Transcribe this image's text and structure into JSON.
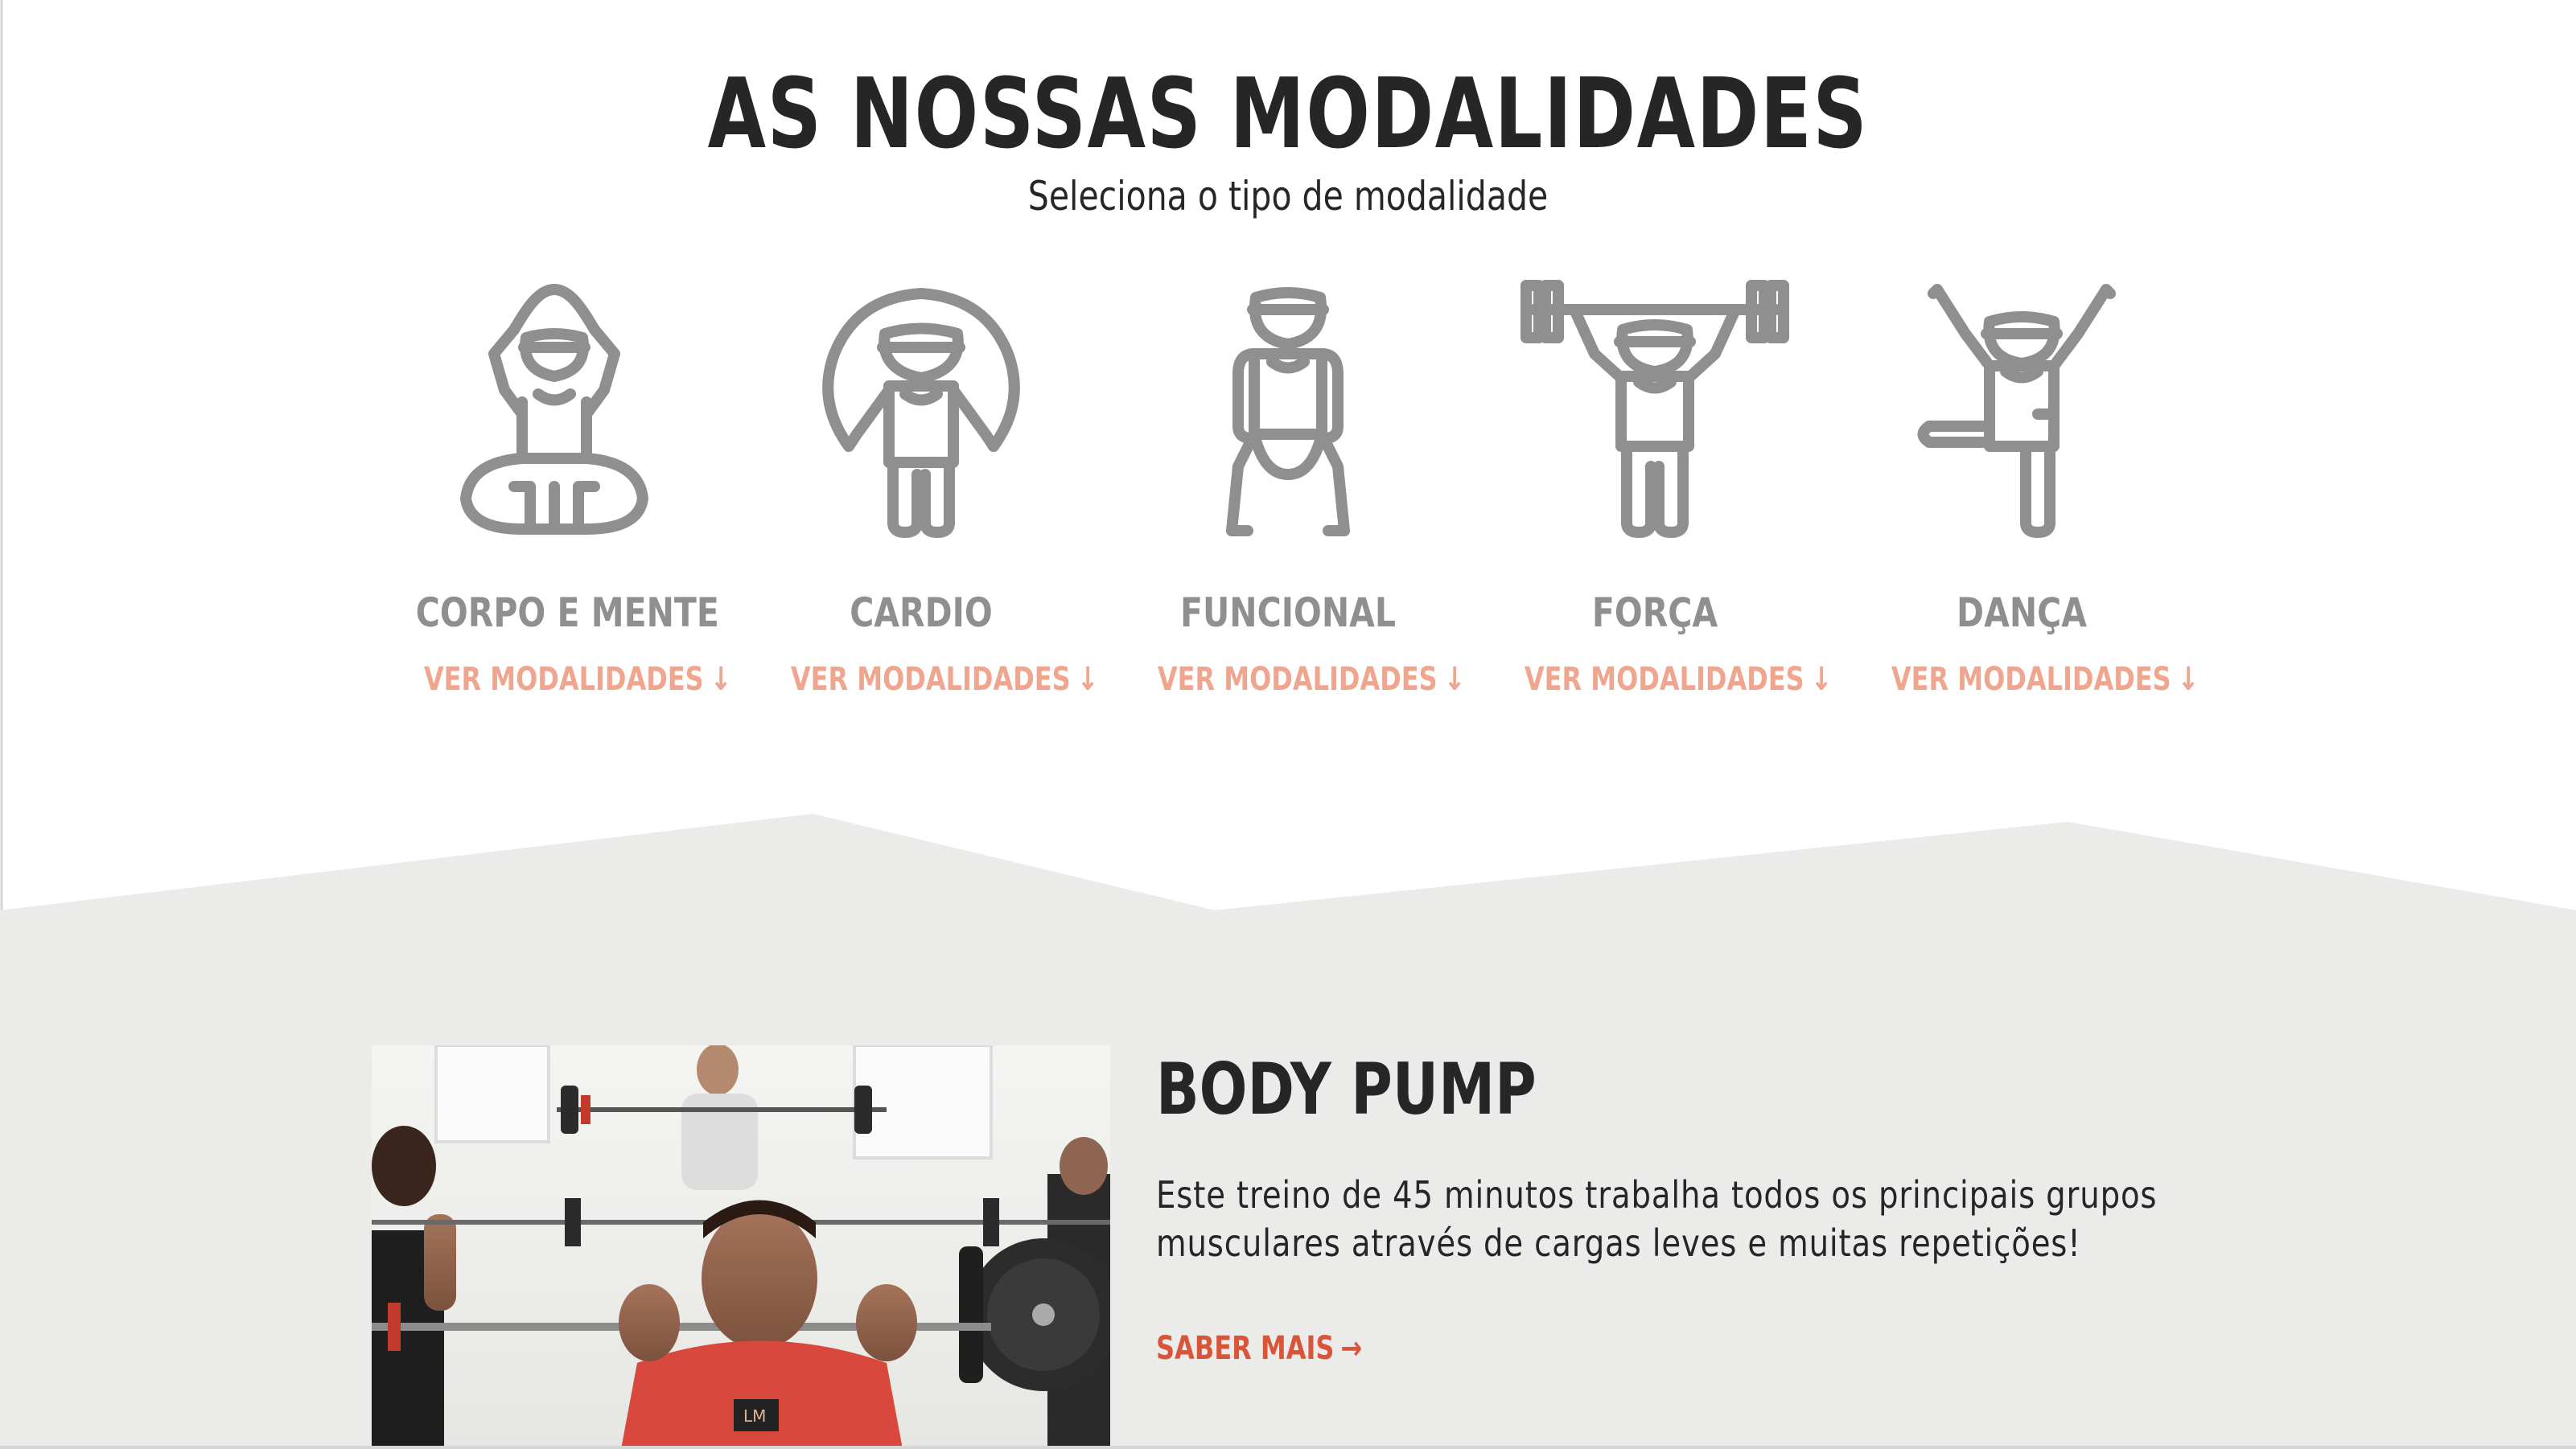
{
  "header": {
    "title": "AS NOSSAS MODALIDADES",
    "subtitle": "Seleciona o tipo de modalidade"
  },
  "categories": [
    {
      "name": "CORPO E MENTE",
      "link": "VER MODALIDADES",
      "icon": "yoga-person-icon"
    },
    {
      "name": "CARDIO",
      "link": "VER MODALIDADES",
      "icon": "jump-rope-person-icon"
    },
    {
      "name": "FUNCIONAL",
      "link": "VER MODALIDADES",
      "icon": "squat-person-icon"
    },
    {
      "name": "FORÇA",
      "link": "VER MODALIDADES",
      "icon": "weightlifting-person-icon"
    },
    {
      "name": "DANÇA",
      "link": "VER MODALIDADES",
      "icon": "dance-person-icon"
    }
  ],
  "link_arrow": "↓",
  "feature": {
    "title": "BODY PUMP",
    "description": "Este treino de 45 minutos trabalha todos os principais grupos musculares através de cargas leves e muitas repetições!",
    "cta": "SABER MAIS",
    "cta_arrow": "→",
    "shirt_logo": "LM"
  },
  "colors": {
    "heading": "#262626",
    "icon_grey": "#8f8f8f",
    "link_light": "#f0a58e",
    "cta": "#d9553a",
    "band": "#ebebea"
  }
}
